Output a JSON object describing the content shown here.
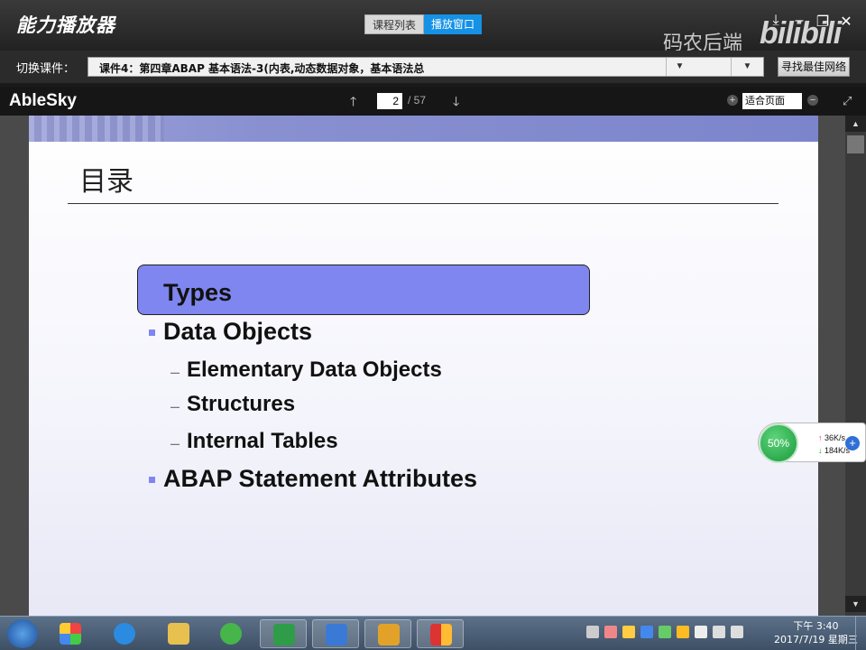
{
  "app": {
    "title": "能力播放器",
    "tabs": [
      {
        "label": "课程列表",
        "active": false
      },
      {
        "label": "播放窗口",
        "active": true
      }
    ],
    "watermark": "码农后端",
    "bili_logo": "bilibili"
  },
  "course": {
    "label": "切换课件：",
    "current": "课件4：第四章ABAP 基本语法-3(内表,动态数据对象，基本语法总",
    "find_button": "寻找最佳网络"
  },
  "viewer": {
    "brand": "AbleSky",
    "page_current": "2",
    "page_total": "/ 57",
    "zoom_mode": "适合页面"
  },
  "slide": {
    "title": "目录",
    "highlight": "Types",
    "items": [
      {
        "text": "Data Objects",
        "level": 1
      },
      {
        "text": "Elementary Data Objects",
        "level": 2
      },
      {
        "text": "Structures",
        "level": 2
      },
      {
        "text": "Internal Tables",
        "level": 2
      },
      {
        "text": "ABAP Statement Attributes",
        "level": 1
      }
    ]
  },
  "network": {
    "percent": "50%",
    "upload": "36K/s",
    "download": "184K/s"
  },
  "taskbar": {
    "time": "下午 3:40",
    "date": "2017/7/19 星期三"
  },
  "colors": {
    "accent_tab": "#1592e6",
    "highlight_box": "#7f86ef",
    "gauge_green": "#199a3c"
  }
}
